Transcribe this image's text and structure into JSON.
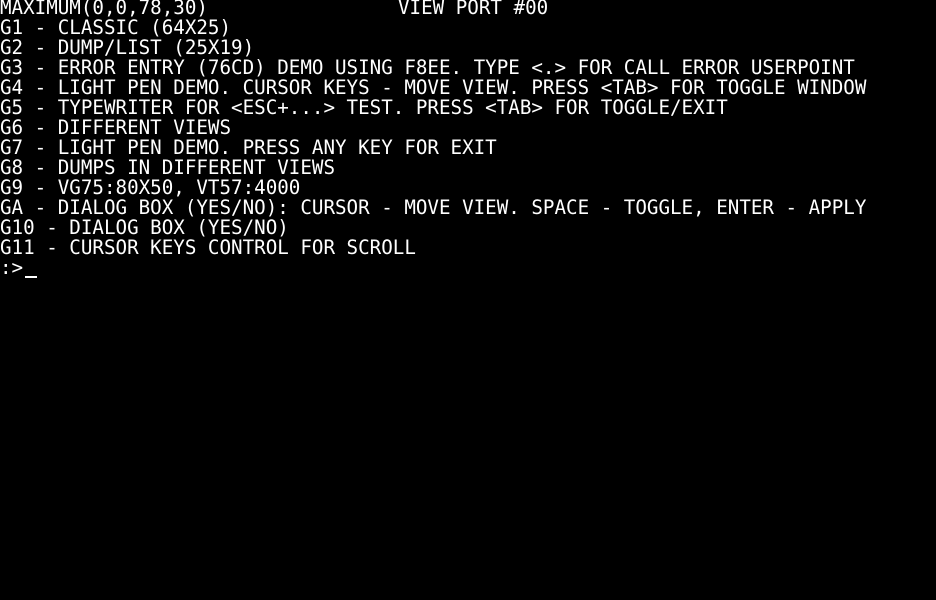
{
  "status": {
    "left": "MAXIMUM(0,0,78,30)",
    "right": "VIEW PORT #00"
  },
  "menu": [
    "G1 - CLASSIC (64X25)",
    "G2 - DUMP/LIST (25X19)",
    "G3 - ERROR ENTRY (76CD) DEMO USING F8EE. TYPE <.> FOR CALL ERROR USERPOINT",
    "G4 - LIGHT PEN DEMO. CURSOR KEYS - MOVE VIEW. PRESS <TAB> FOR TOGGLE WINDOW",
    "G5 - TYPEWRITER FOR <ESC+...> TEST. PRESS <TAB> FOR TOGGLE/EXIT",
    "G6 - DIFFERENT VIEWS",
    "G7 - LIGHT PEN DEMO. PRESS ANY KEY FOR EXIT",
    "G8 - DUMPS IN DIFFERENT VIEWS",
    "G9 - VG75:80X50, VT57:4000",
    "GA - DIALOG BOX (YES/NO): CURSOR - MOVE VIEW. SPACE - TOGGLE, ENTER - APPLY",
    "G10 - DIALOG BOX (YES/NO)",
    "G11 - CURSOR KEYS CONTROL FOR SCROLL"
  ],
  "prompt": ":>",
  "colors": {
    "background": "#000000",
    "text": "#ffffff"
  }
}
